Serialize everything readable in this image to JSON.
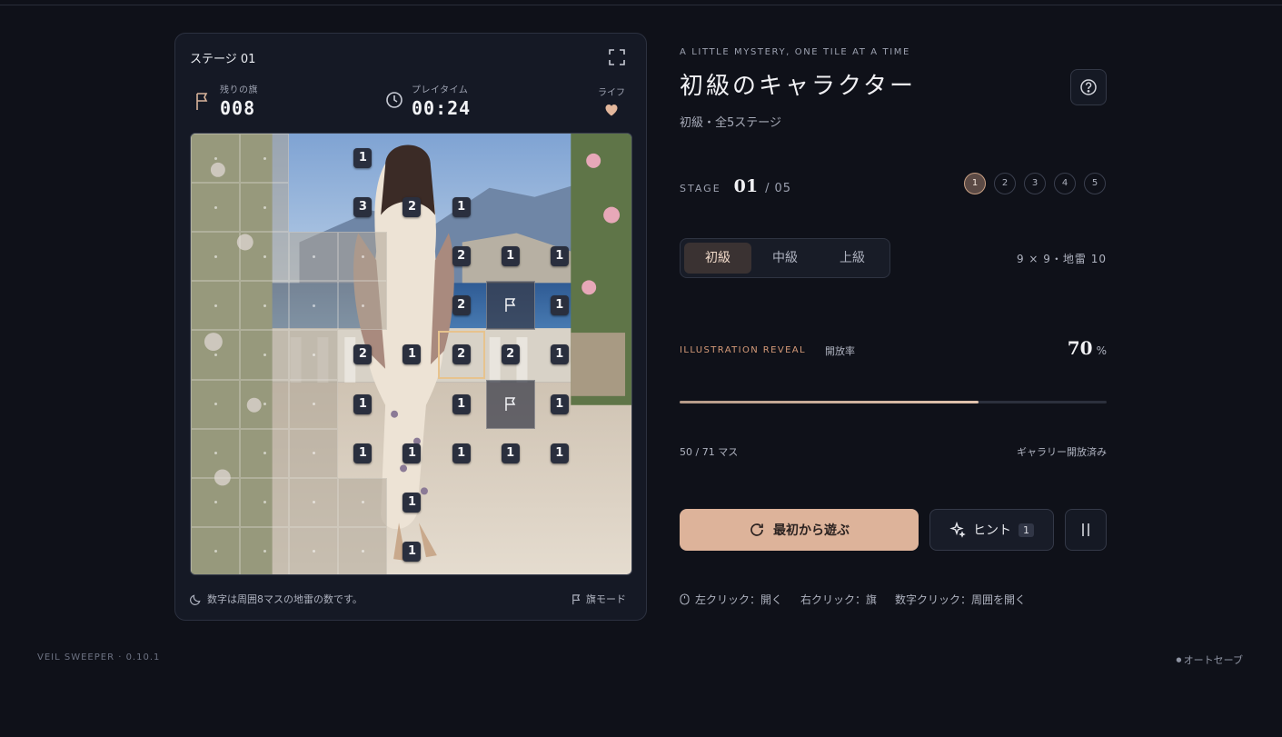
{
  "card": {
    "stage_label": "ステージ 01",
    "flags_label": "残りの旗",
    "flags_value": "008",
    "time_label": "プレイタイム",
    "time_value": "00:24",
    "life_label": "ライフ",
    "footnote": "数字は周囲8マスの地雷の数です。",
    "flag_mode": "旗モード"
  },
  "board": {
    "rows": [
      [
        "h",
        "h",
        "",
        "1",
        "",
        "",
        "",
        "",
        ""
      ],
      [
        "h",
        "h",
        "",
        "3",
        "2",
        "1",
        "",
        "",
        ""
      ],
      [
        "h",
        "h",
        "h",
        "h",
        "",
        "2",
        "1",
        "1",
        ""
      ],
      [
        "h",
        "h",
        "h",
        "h",
        "",
        "2",
        "F",
        "1",
        ""
      ],
      [
        "h",
        "h",
        "h",
        "2",
        "1",
        "2*",
        "2",
        "1",
        ""
      ],
      [
        "h",
        "h",
        "h",
        "1",
        "",
        "1",
        "F",
        "1",
        ""
      ],
      [
        "h",
        "h",
        "h",
        "1",
        "1",
        "1",
        "1",
        "1",
        ""
      ],
      [
        "h",
        "h",
        "h",
        "h",
        "1",
        "",
        "",
        "",
        ""
      ],
      [
        "h",
        "h",
        "h",
        "h",
        "1",
        "",
        "",
        "",
        ""
      ]
    ]
  },
  "panel": {
    "eyebrow": "A LITTLE MYSTERY, ONE TILE AT A TIME",
    "title": "初級のキャラクター",
    "subtitle": "初級・全5ステージ",
    "stage_keyword": "STAGE",
    "stage_current": "01",
    "stage_sep": "/",
    "stage_total": "05",
    "stage_dots": [
      "1",
      "2",
      "3",
      "4",
      "5"
    ],
    "difficulty": [
      "初級",
      "中級",
      "上級"
    ],
    "board_info": "9 × 9・地雷 10",
    "reveal_label": "ILLUSTRATION REVEAL",
    "reveal_jp": "開放率",
    "reveal_percent": 70,
    "reveal_percent_text": "70",
    "reveal_unit": "%",
    "count_text": "50 / 71 マス",
    "gallery_text": "ギャラリー開放済み",
    "restart_label": "最初から遊ぶ",
    "hint_label": "ヒント",
    "hint_count": "1",
    "controls": [
      "左クリック：開く",
      "右クリック：旗",
      "数字クリック：周囲を開く"
    ]
  },
  "footer": {
    "version": "VEIL SWEEPER · 0.10.1",
    "autosave": "オートセーブ"
  },
  "colors": {
    "accent": "#ddb39a",
    "reveal_label": "#d59a78",
    "focus": "#e7c38e"
  }
}
